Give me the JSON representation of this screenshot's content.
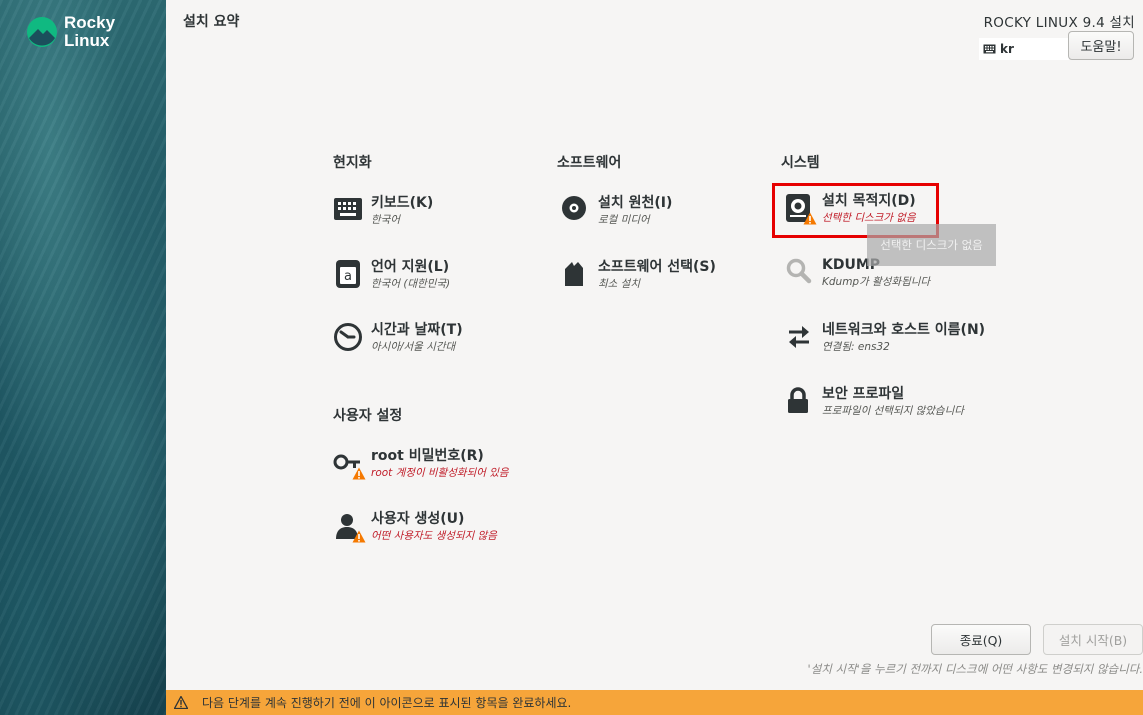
{
  "sidebar": {
    "logo": {
      "line1": "Rocky",
      "line2": "Linux"
    }
  },
  "header": {
    "page_title": "설치 요약",
    "product_title": "ROCKY LINUX 9.4 설치",
    "keyboard_layout": "kr",
    "help_label": "도움말!"
  },
  "sections": {
    "localization": {
      "title": "현지화",
      "keyboard": {
        "title": "키보드(K)",
        "status": "한국어"
      },
      "language": {
        "title": "언어 지원(L)",
        "status": "한국어 (대한민국)"
      },
      "time": {
        "title": "시간과 날짜(T)",
        "status": "아시아/서울 시간대"
      }
    },
    "software": {
      "title": "소프트웨어",
      "source": {
        "title": "설치 원천(I)",
        "status": "로컬 미디어"
      },
      "selection": {
        "title": "소프트웨어 선택(S)",
        "status": "최소 설치"
      }
    },
    "system": {
      "title": "시스템",
      "destination": {
        "title": "설치 목적지(D)",
        "status": "선택한 디스크가 없음"
      },
      "kdump": {
        "title": "KDUMP",
        "status": "Kdump가 활성화됩니다"
      },
      "network": {
        "title": "네트워크와 호스트 이름(N)",
        "status": "연결됨: ens32"
      },
      "security": {
        "title": "보안 프로파일",
        "status": "프로파일이 선택되지 않았습니다"
      }
    },
    "user": {
      "title": "사용자 설정",
      "root": {
        "title": "root 비밀번호(R)",
        "status": "root 계정이 비활성화되어 있음"
      },
      "create_user": {
        "title": "사용자 생성(U)",
        "status": "어떤 사용자도 생성되지 않음"
      }
    }
  },
  "tooltip": "선택한 디스크가 없음",
  "buttons": {
    "quit": "종료(Q)",
    "begin": "설치 시작(B)"
  },
  "footnote": "'설치 시작'을 누르기 전까지 디스크에 어떤 사항도 변경되지 않습니다.",
  "warning_bar": {
    "message": "다음 단계를 계속 진행하기 전에 이 아이콘으로 표시된 항목을 완료하세요."
  },
  "colors": {
    "warning_text": "#c01c28",
    "warning_bar": "#f6a53a",
    "highlight_border": "#e60000"
  }
}
